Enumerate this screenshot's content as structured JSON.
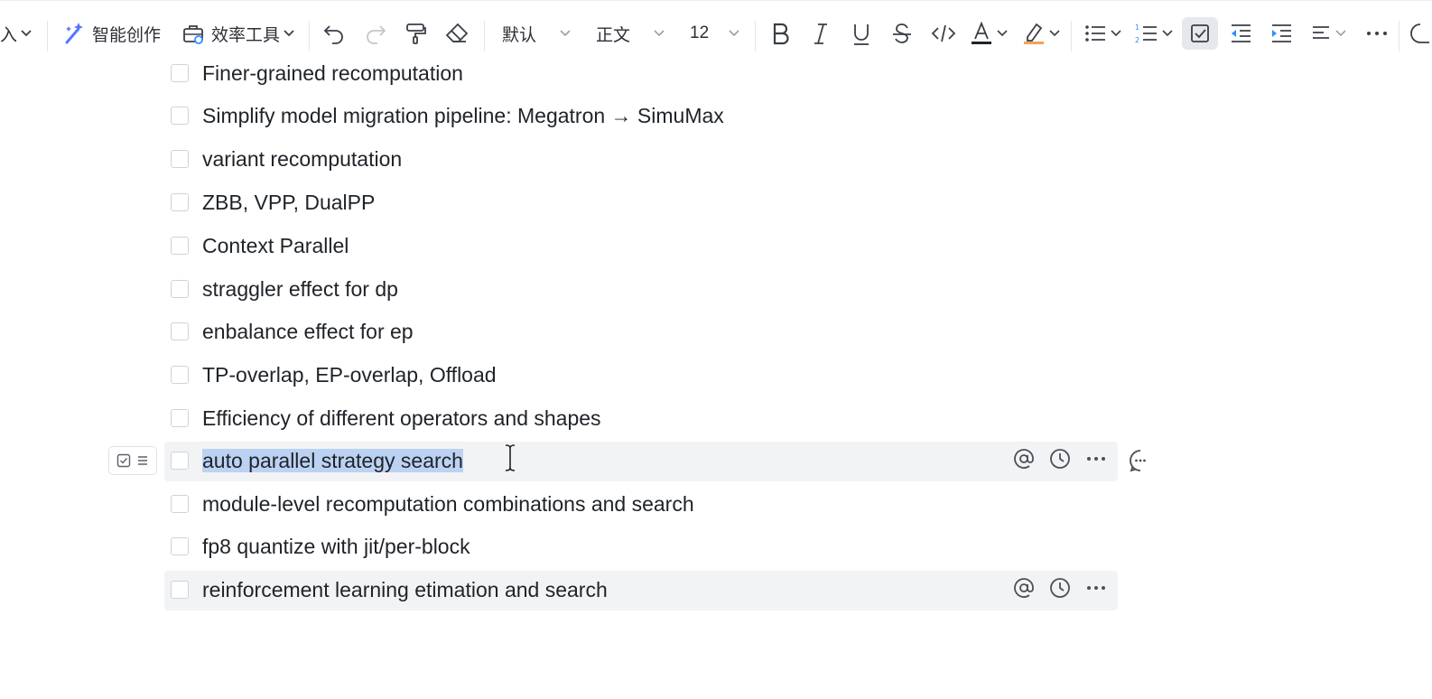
{
  "toolbar": {
    "insert_label": "插入",
    "ai_label": "智能创作",
    "tools_label": "效率工具",
    "style_font_label": "默认",
    "paragraph_style_label": "正文",
    "font_size_label": "12"
  },
  "tasks": [
    {
      "label": "Finer-grained recomputation"
    },
    {
      "label": "Simplify model migration pipeline: Megatron → SimuMax"
    },
    {
      "label": "variant recomputation"
    },
    {
      "label": "ZBB, VPP, DualPP"
    },
    {
      "label": "Context Parallel"
    },
    {
      "label": "straggler effect for dp"
    },
    {
      "label": "enbalance effect for ep"
    },
    {
      "label": "TP-overlap, EP-overlap, Offload"
    },
    {
      "label": "Efficiency of different operators and shapes"
    },
    {
      "label": "auto parallel strategy search"
    },
    {
      "label": "module-level recomputation combinations and search"
    },
    {
      "label": "fp8 quantize with jit/per-block"
    },
    {
      "label": "reinforcement learning etimation and search"
    }
  ],
  "colors": {
    "selection": "#bcd2f3",
    "row_hover": "#f2f3f5",
    "ai_gradient_start": "#7b61ff",
    "ai_gradient_end": "#2f8cff",
    "text_underline_color": "#1f2329",
    "highlighter_color": "#f0a35a"
  },
  "icons": {
    "undo": "undo-icon",
    "redo": "redo-icon",
    "format_painter": "format-painter-icon",
    "eraser": "eraser-icon",
    "bold": "bold-icon",
    "italic": "italic-icon",
    "underline": "underline-icon",
    "strike": "strikethrough-icon",
    "code": "code-icon",
    "font_color": "font-color-icon",
    "highlight": "highlight-icon",
    "bullet_list": "bullet-list-icon",
    "ordered_list": "ordered-list-icon",
    "task_list": "task-list-icon",
    "outdent": "outdent-icon",
    "indent": "indent-icon",
    "align": "align-icon",
    "more": "more-icon",
    "mention": "mention-icon",
    "reminder": "clock-icon",
    "comment": "comment-icon"
  }
}
